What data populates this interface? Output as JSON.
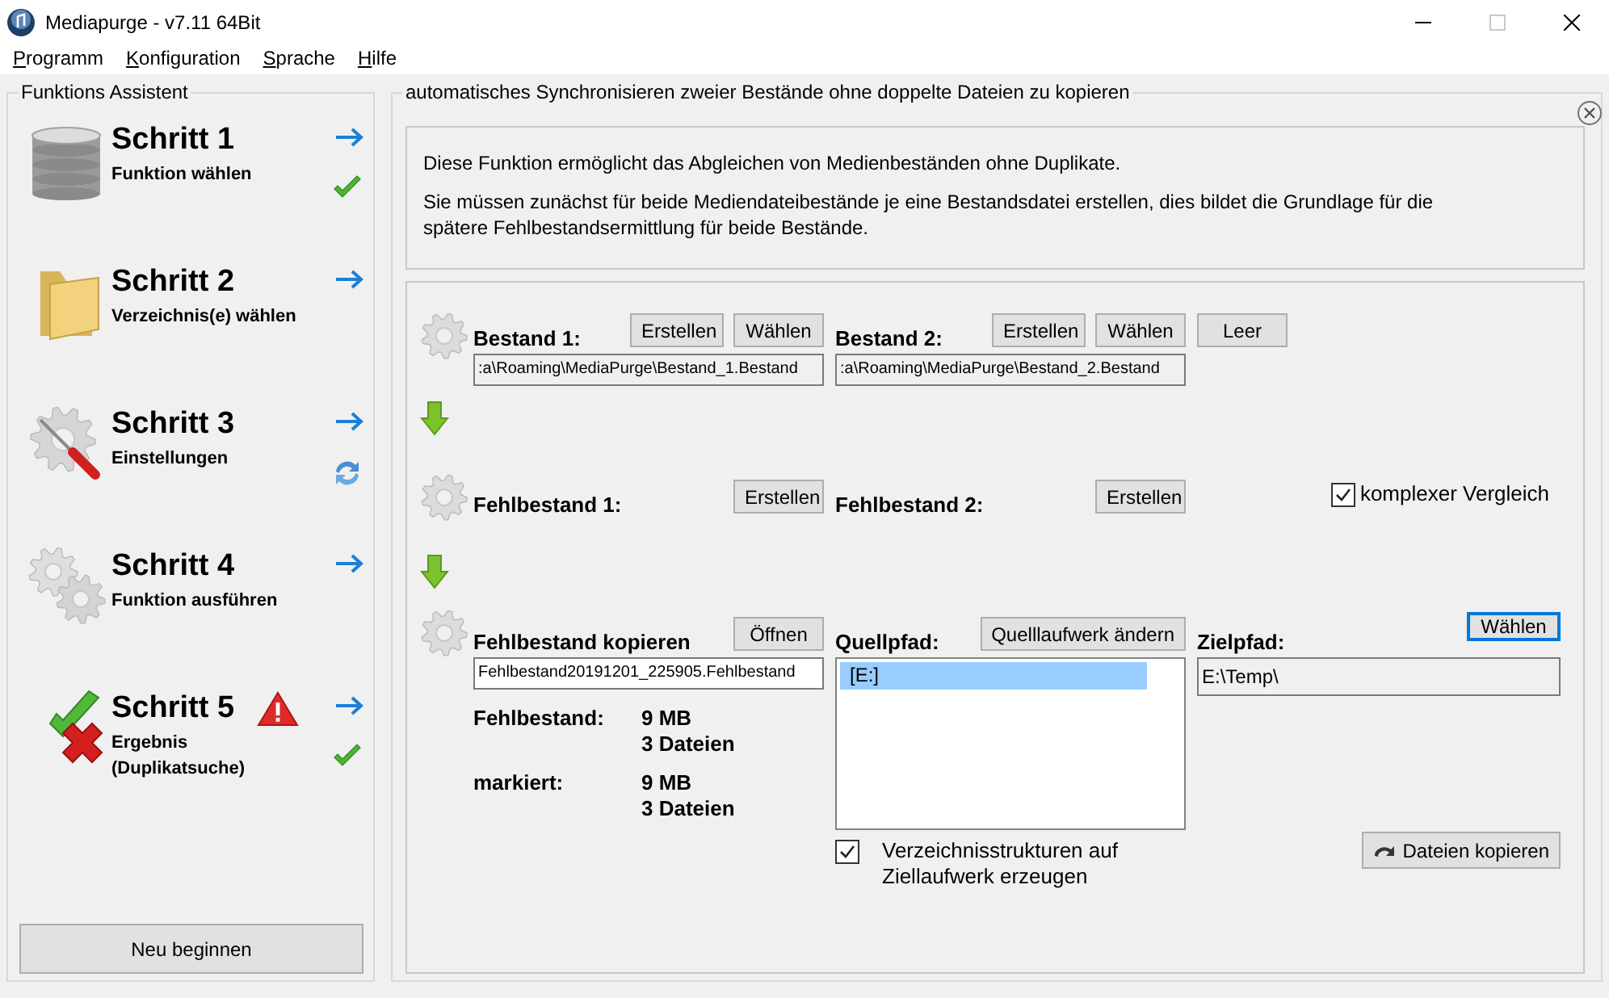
{
  "window": {
    "title": "Mediapurge - v7.11 64Bit"
  },
  "menu": [
    {
      "label": "Programm",
      "underline_first": true
    },
    {
      "label": "Konfiguration",
      "underline_first": true
    },
    {
      "label": "Sprache",
      "underline_first": true
    },
    {
      "label": "Hilfe",
      "underline_first": true
    }
  ],
  "sidebar": {
    "title": "Funktions Assistent",
    "steps": [
      {
        "kind": "database",
        "title": "Schritt 1",
        "subtitle": "Funktion wählen",
        "done": true,
        "refresh": false,
        "warning": false
      },
      {
        "kind": "folder",
        "title": "Schritt 2",
        "subtitle": "Verzeichnis(e) wählen",
        "done": false,
        "refresh": false,
        "warning": false
      },
      {
        "kind": "tools",
        "title": "Schritt 3",
        "subtitle": "Einstellungen",
        "done": false,
        "refresh": true,
        "warning": false
      },
      {
        "kind": "gears",
        "title": "Schritt 4",
        "subtitle": "Funktion ausführen",
        "done": false,
        "refresh": false,
        "warning": false
      },
      {
        "kind": "result",
        "title": "Schritt 5",
        "subtitle": "Ergebnis\n(Duplikatsuche)",
        "done": true,
        "refresh": false,
        "warning": true
      }
    ],
    "button": "Neu beginnen"
  },
  "main": {
    "heading": "automatisches Synchronisieren zweier Bestände ohne doppelte Dateien zu kopieren",
    "info": [
      "Diese Funktion ermöglicht das Abgleichen von Medienbeständen ohne Duplikate.",
      "Sie müssen zunächst für beide Mediendateibestände je eine Bestandsdatei erstellen, dies bildet die Grundlage für die spätere Fehlbestandsermittlung für beide Bestände."
    ],
    "bestand": [
      {
        "label": "Bestand 1:",
        "buttons": [
          "Erstellen",
          "Wählen"
        ],
        "path": ":a\\Roaming\\MediaPurge\\Bestand_1.Bestand"
      },
      {
        "label": "Bestand 2:",
        "buttons": [
          "Erstellen",
          "Wählen"
        ],
        "path": ":a\\Roaming\\MediaPurge\\Bestand_2.Bestand"
      }
    ],
    "bestand_extra_button": "Leer",
    "fehlbestand": [
      {
        "label": "Fehlbestand 1:",
        "button": "Erstellen"
      },
      {
        "label": "Fehlbestand 2:",
        "button": "Erstellen"
      }
    ],
    "compare_option": {
      "label": "komplexer Vergleich",
      "checked": true
    },
    "copy": {
      "label": "Fehlbestand kopieren",
      "button": "Öffnen",
      "file": "Fehlbestand20191201_225905.Fehlbestand",
      "stats": [
        {
          "label": "Fehlbestand:",
          "size": "9 MB",
          "files": "3 Dateien"
        },
        {
          "label": "markiert:",
          "size": "9 MB",
          "files": "3 Dateien"
        }
      ]
    },
    "source": {
      "label": "Quellpfad:",
      "button": "Quelllaufwerk ändern",
      "drives": [
        {
          "label": "[E:]",
          "selected": true
        }
      ],
      "option": {
        "label": "Verzeichnisstrukturen auf Ziellaufwerk erzeugen",
        "checked": true
      }
    },
    "target": {
      "label": "Zielpfad:",
      "button": "Wählen",
      "button_focused": true,
      "path": "E:\\Temp\\",
      "action": "Dateien kopieren"
    }
  }
}
